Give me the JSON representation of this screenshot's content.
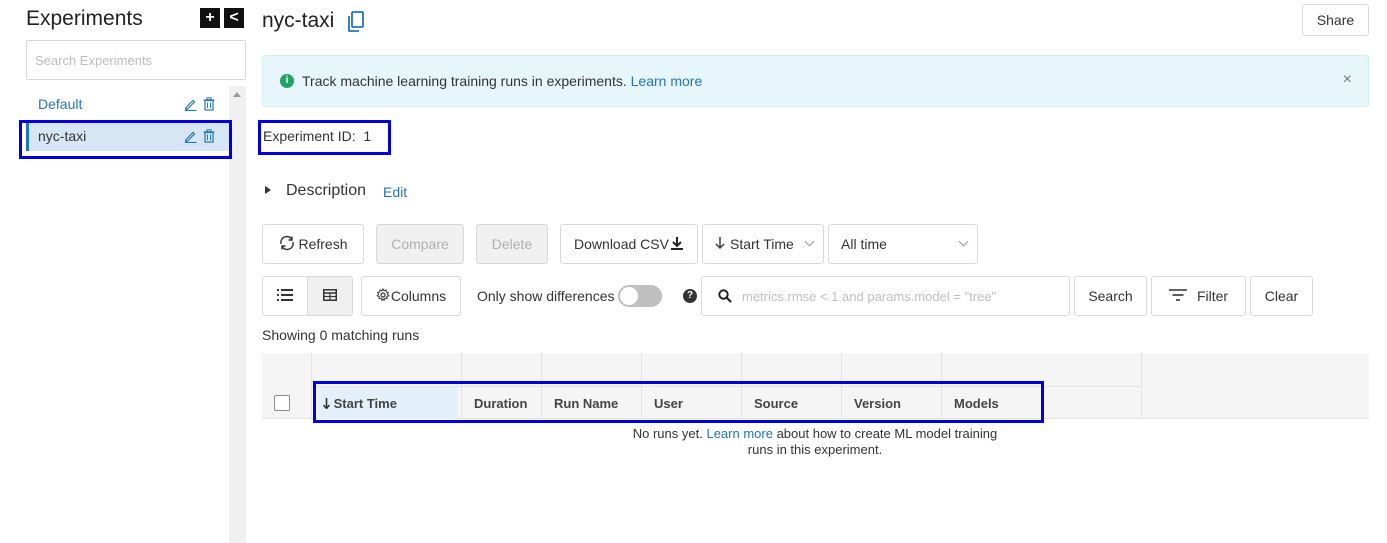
{
  "sidebar": {
    "title": "Experiments",
    "add_label": "+",
    "collapse_label": "<",
    "search_placeholder": "Search Experiments",
    "experiments": [
      {
        "name": "Default"
      },
      {
        "name": "nyc-taxi"
      }
    ]
  },
  "header": {
    "title": "nyc-taxi",
    "share_label": "Share"
  },
  "banner": {
    "info_glyph": "i",
    "text": "Track machine learning training runs in experiments.",
    "link": "Learn more",
    "close_glyph": "×"
  },
  "experiment": {
    "id_label": "Experiment ID:",
    "id_value": "1"
  },
  "description": {
    "label": "Description",
    "edit": "Edit"
  },
  "toolbar": {
    "refresh": "Refresh",
    "compare": "Compare",
    "delete": "Delete",
    "download_csv": "Download CSV",
    "sort": "Start Time",
    "time_range": "All time",
    "columns": "Columns",
    "only_differences": "Only show differences",
    "help_glyph": "?",
    "search_placeholder": "metrics.rmse < 1 and params.model = \"tree\"",
    "search": "Search",
    "filter": "Filter",
    "clear": "Clear"
  },
  "runs": {
    "showing": "Showing 0 matching runs",
    "columns": [
      "Start Time",
      "Duration",
      "Run Name",
      "User",
      "Source",
      "Version",
      "Models"
    ],
    "empty_before": "No runs yet.",
    "empty_link": "Learn more",
    "empty_after": "about how to create ML model training runs in this experiment."
  },
  "colors": {
    "accent": "#2374bb",
    "highlight": "#0000e0",
    "banner_bg": "#e6f6fa",
    "info_green": "#1ea362"
  }
}
